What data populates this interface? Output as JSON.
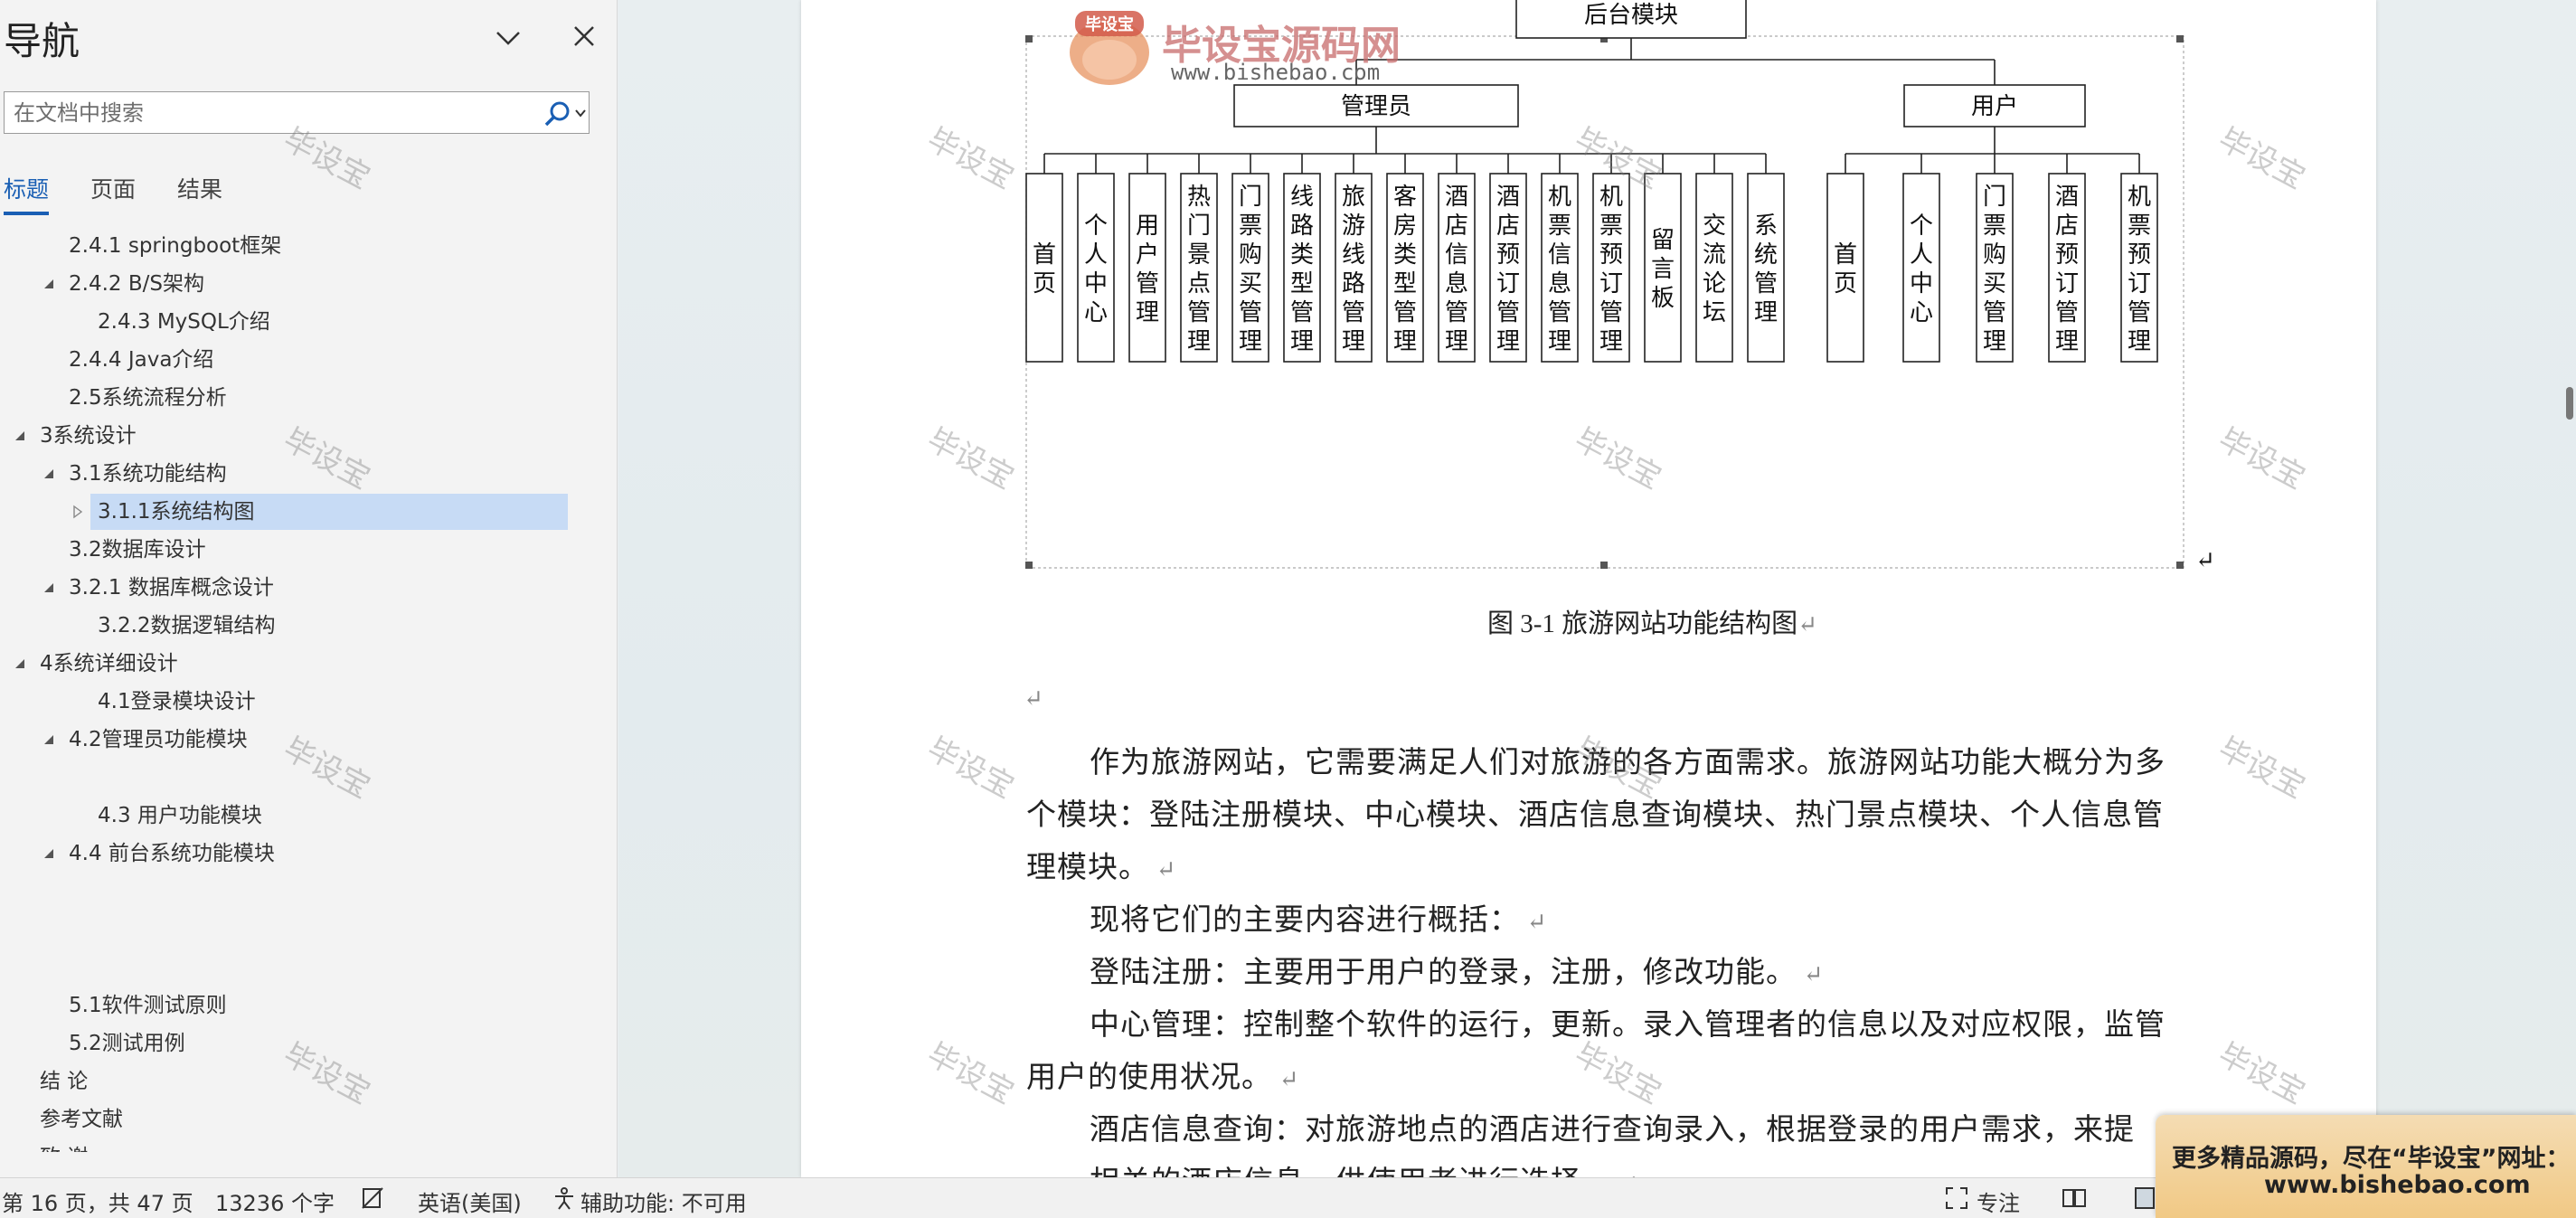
{
  "nav": {
    "title": "导航",
    "search_placeholder": "在文档中搜索",
    "tabs": [
      {
        "label": "标题",
        "active": true
      },
      {
        "label": "页面",
        "active": false
      },
      {
        "label": "结果",
        "active": false
      }
    ],
    "tree": [
      {
        "label": "2.4.1 springboot框架",
        "level": 2,
        "toggle": "none"
      },
      {
        "label": "2.4.2 B/S架构",
        "level": 2,
        "toggle": "expanded"
      },
      {
        "label": "2.4.3 MySQL介绍",
        "level": 3,
        "toggle": "none"
      },
      {
        "label": "2.4.4 Java介绍",
        "level": 2,
        "toggle": "none"
      },
      {
        "label": "2.5系统流程分析",
        "level": 2,
        "toggle": "none"
      },
      {
        "label": "3系统设计",
        "level": 1,
        "toggle": "expanded"
      },
      {
        "label": "3.1系统功能结构",
        "level": 2,
        "toggle": "expanded"
      },
      {
        "label": "3.1.1系统结构图",
        "level": 3,
        "toggle": "collapsed",
        "selected": true
      },
      {
        "label": "3.2数据库设计",
        "level": 2,
        "toggle": "none"
      },
      {
        "label": "3.2.1 数据库概念设计",
        "level": 2,
        "toggle": "expanded"
      },
      {
        "label": "3.2.2数据逻辑结构",
        "level": 3,
        "toggle": "none"
      },
      {
        "label": "4系统详细设计",
        "level": 1,
        "toggle": "expanded"
      },
      {
        "label": "4.1登录模块设计",
        "level": 3,
        "toggle": "none"
      },
      {
        "label": "4.2管理员功能模块",
        "level": 2,
        "toggle": "expanded"
      },
      {
        "label": "",
        "level": 3,
        "toggle": "none"
      },
      {
        "label": "4.3 用户功能模块",
        "level": 3,
        "toggle": "none"
      },
      {
        "label": "4.4 前台系统功能模块",
        "level": 2,
        "toggle": "expanded"
      },
      {
        "label": "",
        "level": 3,
        "toggle": "none"
      },
      {
        "label": "",
        "level": 3,
        "toggle": "none"
      },
      {
        "label": "",
        "level": 3,
        "toggle": "none"
      },
      {
        "label": "5.1软件测试原则",
        "level": 2,
        "toggle": "none"
      },
      {
        "label": "5.2测试用例",
        "level": 2,
        "toggle": "none"
      },
      {
        "label": "结  论",
        "level": 1,
        "toggle": "none"
      },
      {
        "label": "参考文献",
        "level": 1,
        "toggle": "none"
      },
      {
        "label": "致  谢",
        "level": 1,
        "toggle": "none"
      }
    ]
  },
  "logo": {
    "badge": "毕设宝",
    "name": "毕设宝源码网",
    "url": "www.bishebao.com"
  },
  "watermark_text": "毕设宝",
  "diagram": {
    "root": "后台模块",
    "admin": {
      "label": "管理员",
      "children": [
        "首页",
        "个人中心",
        "用户管理",
        "热门景点管理",
        "门票购买管理",
        "线路类型管理",
        "旅游线路管理",
        "客房类型管理",
        "酒店信息管理",
        "酒店预订管理",
        "机票信息管理",
        "机票预订管理",
        "留言板",
        "交流论坛",
        "系统管理"
      ]
    },
    "user": {
      "label": "用户",
      "children": [
        "首页",
        "个人中心",
        "门票购买管理",
        "酒店预订管理",
        "机票预订管理"
      ]
    }
  },
  "document": {
    "caption": "图 3-1  旅游网站功能结构图",
    "paragraphs": [
      "作为旅游网站，它需要满足人们对旅游的各方面需求。旅游网站功能大概分为多",
      "个模块：登陆注册模块、中心模块、酒店信息查询模块、热门景点模块、个人信息管",
      "理模块。",
      "现将它们的主要内容进行概括：",
      "登陆注册：主要用于用户的登录，注册，修改功能。",
      "中心管理：控制整个软件的运行，更新。录入管理者的信息以及对应权限，监管",
      "用户的使用状况。",
      "酒店信息查询：对旅游地点的酒店进行查询录入，根据登录的用户需求，来提",
      "相关的酒店信息，供使用者进行选择。"
    ]
  },
  "status": {
    "page": "第 16 页，共 47 页",
    "words": "13236 个字",
    "language": "英语(美国)",
    "accessibility": "辅助功能: 不可用",
    "focus": "专注"
  },
  "ad": {
    "line1": "更多精品源码，尽在“毕设宝”网址：",
    "line2": "www.bishebao.com"
  }
}
